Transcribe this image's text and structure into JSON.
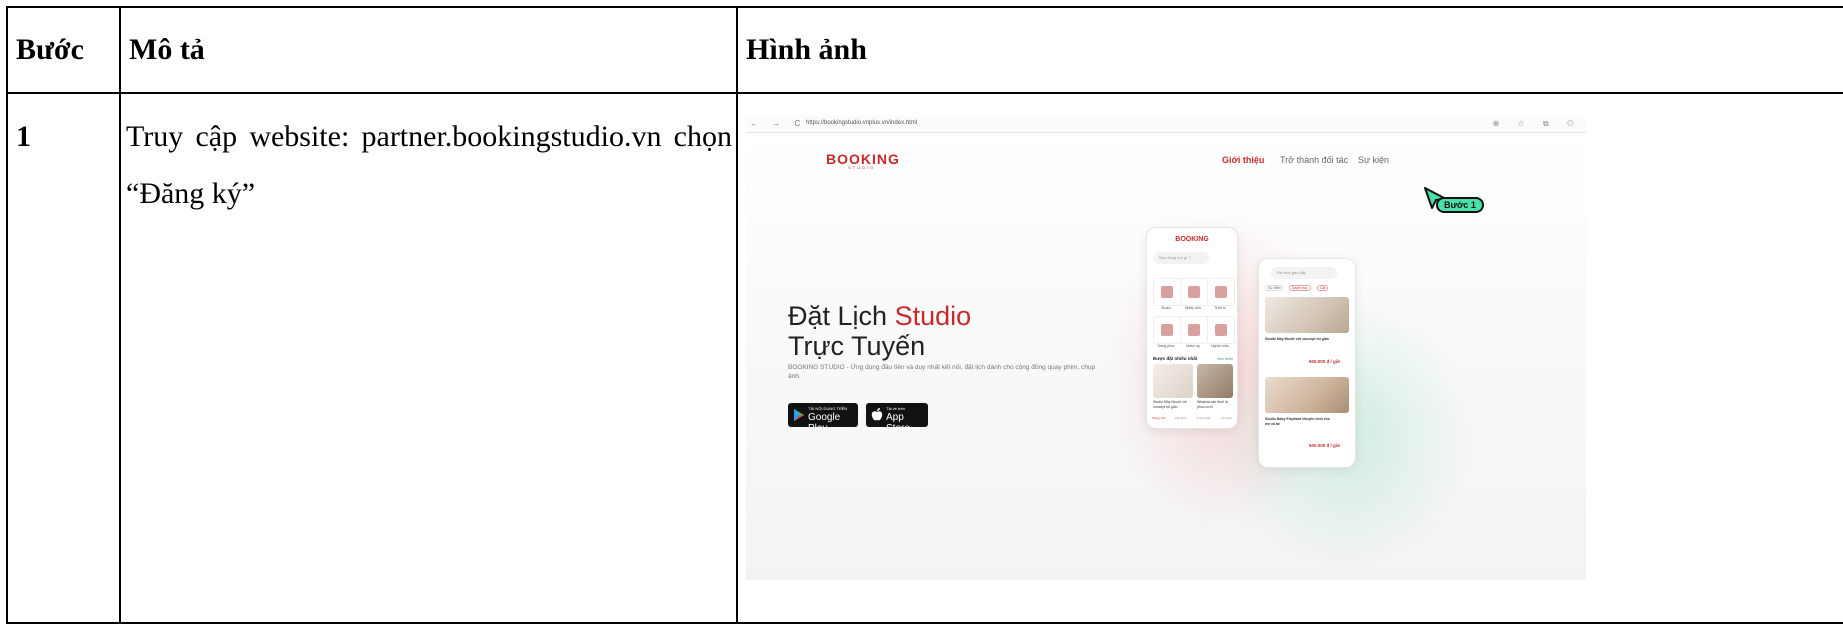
{
  "table": {
    "headers": [
      "Bước",
      "Mô tả",
      "Hình ảnh"
    ],
    "rows": [
      {
        "step": "1",
        "description": "Truy cập website: partner.bookingstudio.vn chọn “Đăng ký”"
      }
    ]
  },
  "screenshot": {
    "browser": {
      "url": "https://bookingstudio.vnplus.vn/index.html"
    },
    "site": {
      "logo": "BOOKING",
      "logo_sub": "STUDIO",
      "nav": [
        "Giới thiệu",
        "Trở thành đối tác",
        "Sự kiện"
      ],
      "step_badge": "Bước 1",
      "hero_title_line1": "Đặt Lịch",
      "hero_title_highlight": "Studio",
      "hero_title_line2": "Trực Tuyến",
      "hero_description": "BOOKING STUDIO - Ứng dụng đầu tiên và duy nhất kết nối, đặt lịch dành cho cộng đồng quay phim, chụp ảnh.",
      "google_play_small": "TẢI NỘI DUNG TRÊN",
      "google_play": "Google Play",
      "app_store_small": "Tải về trên",
      "app_store": "App Store",
      "phone1": {
        "logo": "BOOKING",
        "search": "Bạn đang tìm gì ?",
        "categories": [
          "Studio",
          "Nhiếp ảnh",
          "Thiết bị",
          "Trang phục",
          "Make up",
          "Người mẫu"
        ],
        "section": "Được đặt nhiều nhất",
        "see_more": "Xem thêm",
        "cards": [
          "Studio Mây Moulé với concept tối giản",
          "Wisteria căn thuê là phục cưới"
        ],
        "tabbar": [
          "Trang chủ",
          "Đã thích",
          "Thông báo",
          "Cá nhân"
        ]
      },
      "phone2": {
        "search": "Đã xem gần đây",
        "filters": [
          "Sự điểm",
          "Danh mục",
          "Giá"
        ],
        "listings": [
          {
            "title": "Studio Mây Moulé với concept tối giản",
            "price": "600.000 đ / giờ"
          },
          {
            "title": "Studio Baby Elephant chuyên hình cho mẹ và bé",
            "price": "500.000 đ / giờ"
          }
        ]
      }
    }
  }
}
